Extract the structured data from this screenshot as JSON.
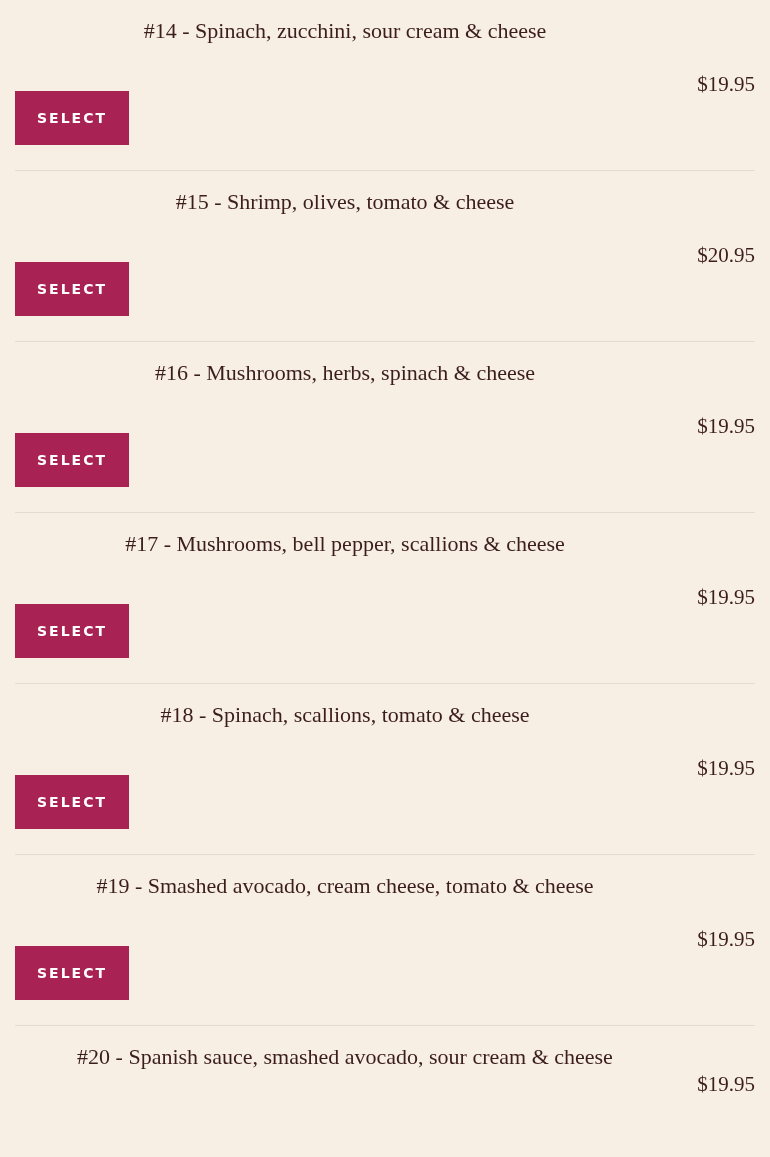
{
  "items": [
    {
      "title": "#14 - Spinach, zucchini, sour cream & cheese",
      "price": "$19.95",
      "button": "SELECT"
    },
    {
      "title": "#15 - Shrimp, olives, tomato & cheese",
      "price": "$20.95",
      "button": "SELECT"
    },
    {
      "title": "#16 - Mushrooms, herbs, spinach & cheese",
      "price": "$19.95",
      "button": "SELECT"
    },
    {
      "title": "#17 - Mushrooms, bell pepper, scallions & cheese",
      "price": "$19.95",
      "button": "SELECT"
    },
    {
      "title": "#18 - Spinach, scallions, tomato & cheese",
      "price": "$19.95",
      "button": "SELECT"
    },
    {
      "title": "#19 - Smashed avocado, cream cheese, tomato & cheese",
      "price": "$19.95",
      "button": "SELECT"
    },
    {
      "title": "#20 - Spanish sauce, smashed avocado, sour cream & cheese",
      "price": "$19.95"
    }
  ]
}
